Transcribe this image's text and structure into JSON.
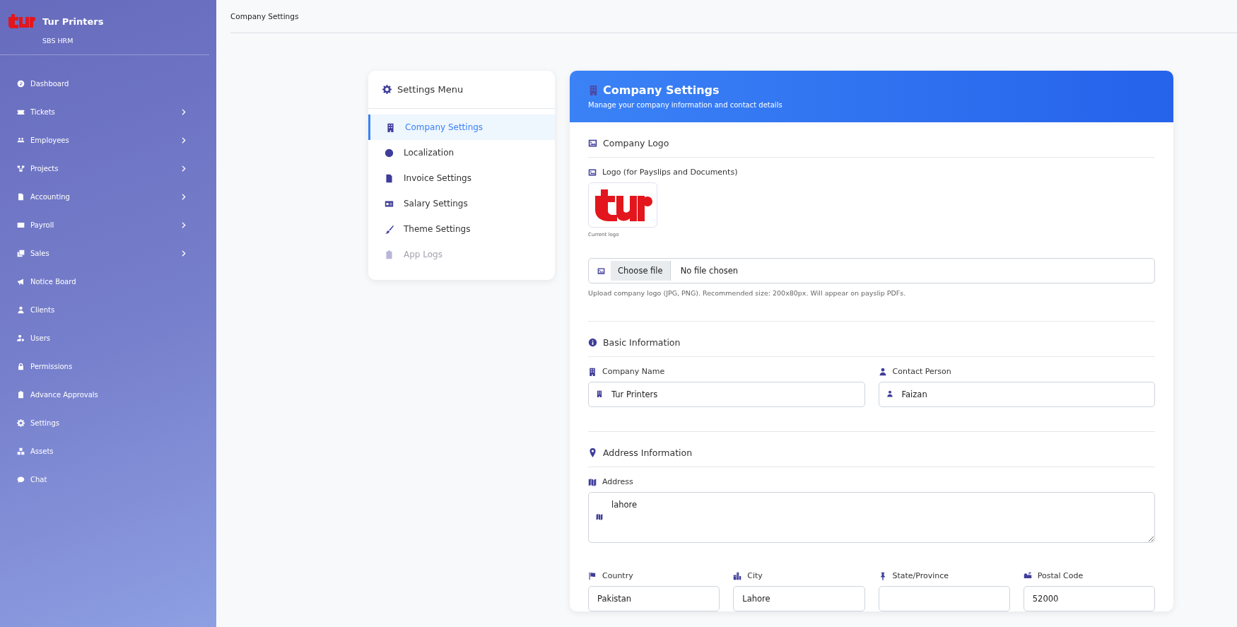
{
  "sidebar": {
    "brand": {
      "name": "Tur Printers",
      "subtitle": "SBS HRM"
    },
    "items": [
      {
        "label": "Dashboard",
        "has_submenu": false
      },
      {
        "label": "Tickets",
        "has_submenu": true
      },
      {
        "label": "Employees",
        "has_submenu": true
      },
      {
        "label": "Projects",
        "has_submenu": true
      },
      {
        "label": "Accounting",
        "has_submenu": true
      },
      {
        "label": "Payroll",
        "has_submenu": true
      },
      {
        "label": "Sales",
        "has_submenu": true
      },
      {
        "label": "Notice Board",
        "has_submenu": false
      },
      {
        "label": "Clients",
        "has_submenu": false
      },
      {
        "label": "Users",
        "has_submenu": false
      },
      {
        "label": "Permissions",
        "has_submenu": false
      },
      {
        "label": "Advance Approvals",
        "has_submenu": false
      },
      {
        "label": "Settings",
        "has_submenu": false
      },
      {
        "label": "Assets",
        "has_submenu": false
      },
      {
        "label": "Chat",
        "has_submenu": false
      }
    ]
  },
  "topbar": {
    "title": "Company Settings"
  },
  "settings_menu": {
    "title": "Settings Menu",
    "items": [
      {
        "label": "Company Settings",
        "selected": true,
        "disabled": false
      },
      {
        "label": "Localization",
        "selected": false,
        "disabled": false
      },
      {
        "label": "Invoice Settings",
        "selected": false,
        "disabled": false
      },
      {
        "label": "Salary Settings",
        "selected": false,
        "disabled": false
      },
      {
        "label": "Theme Settings",
        "selected": false,
        "disabled": false
      },
      {
        "label": "App Logs",
        "selected": false,
        "disabled": true
      }
    ]
  },
  "panel": {
    "title": "Company Settings",
    "subtitle": "Manage your company information and contact details",
    "logo_section": {
      "title": "Company Logo",
      "field_label": "Logo (for Payslips and Documents)",
      "caption": "Current logo",
      "file_button": "Choose file",
      "file_status": "No file chosen",
      "help": "Upload company logo (JPG, PNG). Recommended size: 200x80px. Will appear on payslip PDFs."
    },
    "basic_section": {
      "title": "Basic Information",
      "fields": [
        {
          "label": "Company Name",
          "value": "Tur Printers"
        },
        {
          "label": "Contact Person",
          "value": "Faizan"
        }
      ]
    },
    "address_section": {
      "title": "Address Information",
      "address": {
        "label": "Address",
        "value": "lahore"
      },
      "fields": [
        {
          "label": "Country",
          "value": "Pakistan"
        },
        {
          "label": "City",
          "value": "Lahore"
        },
        {
          "label": "State/Province"
        },
        {
          "label": "Postal Code",
          "value": "52000"
        }
      ]
    }
  }
}
